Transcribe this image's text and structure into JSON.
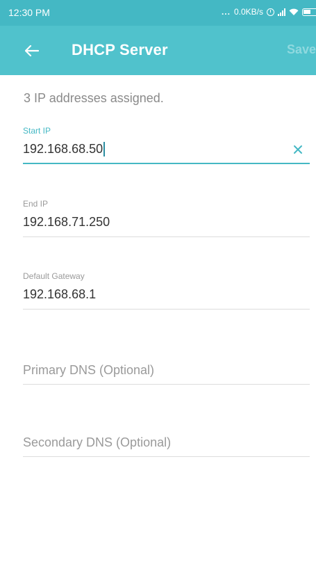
{
  "status_bar": {
    "time": "12:30 PM",
    "dots": "...",
    "network_speed": "0.0KB/s",
    "icons": [
      "alarm-icon",
      "signal-icon",
      "wifi-icon",
      "battery-icon"
    ]
  },
  "toolbar": {
    "back_icon": "arrow-left-icon",
    "title": "DHCP Server",
    "save_label": "Save"
  },
  "summary": "3 IP addresses assigned.",
  "fields": {
    "start_ip": {
      "label": "Start IP",
      "value": "192.168.68.50",
      "focused": true
    },
    "end_ip": {
      "label": "End IP",
      "value": "192.168.71.250"
    },
    "default_gateway": {
      "label": "Default Gateway",
      "value": "192.168.68.1"
    },
    "primary_dns": {
      "placeholder": "Primary DNS (Optional)",
      "value": ""
    },
    "secondary_dns": {
      "placeholder": "Secondary DNS (Optional)",
      "value": ""
    }
  },
  "colors": {
    "accent": "#50c2cc",
    "status_bar": "#44b8c4",
    "text_primary": "#333333",
    "text_secondary": "#9a9a9a"
  }
}
